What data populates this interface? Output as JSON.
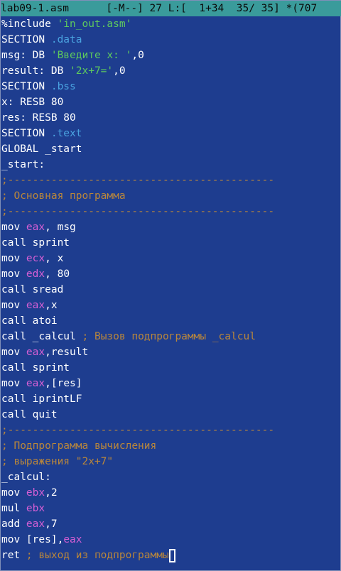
{
  "status": {
    "filename": "lab09-1.asm",
    "info": "[-M--] 27 L:[  1+34  35/ 35] *(707"
  },
  "colors": {
    "background": "#1e3d8f",
    "status_bar": "#3a9b9b",
    "register": "#d45fd4",
    "string": "#5ec95e",
    "comment": "#b8863c",
    "section_name": "#4aa3e0"
  },
  "lines": [
    [
      {
        "t": "%include ",
        "c": "kw"
      },
      {
        "t": "'in_out.asm'",
        "c": "str"
      }
    ],
    [
      {
        "t": "SECTION ",
        "c": "kw"
      },
      {
        "t": ".data",
        "c": "sec"
      }
    ],
    [
      {
        "t": "msg: DB ",
        "c": "kw"
      },
      {
        "t": "'Введите x: '",
        "c": "str"
      },
      {
        "t": ",0",
        "c": "kw"
      }
    ],
    [
      {
        "t": "result: DB ",
        "c": "kw"
      },
      {
        "t": "'2x+7='",
        "c": "str"
      },
      {
        "t": ",0",
        "c": "kw"
      }
    ],
    [
      {
        "t": "SECTION ",
        "c": "kw"
      },
      {
        "t": ".bss",
        "c": "sec"
      }
    ],
    [
      {
        "t": "x: RESB 80",
        "c": "kw"
      }
    ],
    [
      {
        "t": "res: RESB 80",
        "c": "kw"
      }
    ],
    [
      {
        "t": "SECTION ",
        "c": "kw"
      },
      {
        "t": ".text",
        "c": "sec"
      }
    ],
    [
      {
        "t": "GLOBAL _start",
        "c": "kw"
      }
    ],
    [
      {
        "t": "_start:",
        "c": "kw"
      }
    ],
    [
      {
        "t": ";-------------------------------------------",
        "c": "cmt"
      }
    ],
    [
      {
        "t": "; Основная программа",
        "c": "cmt"
      }
    ],
    [
      {
        "t": ";-------------------------------------------",
        "c": "cmt"
      }
    ],
    [
      {
        "t": "mov ",
        "c": "kw"
      },
      {
        "t": "eax",
        "c": "reg"
      },
      {
        "t": ", msg",
        "c": "kw"
      }
    ],
    [
      {
        "t": "call sprint",
        "c": "kw"
      }
    ],
    [
      {
        "t": "mov ",
        "c": "kw"
      },
      {
        "t": "ecx",
        "c": "reg"
      },
      {
        "t": ", x",
        "c": "kw"
      }
    ],
    [
      {
        "t": "mov ",
        "c": "kw"
      },
      {
        "t": "edx",
        "c": "reg"
      },
      {
        "t": ", 80",
        "c": "kw"
      }
    ],
    [
      {
        "t": "call sread",
        "c": "kw"
      }
    ],
    [
      {
        "t": "mov ",
        "c": "kw"
      },
      {
        "t": "eax",
        "c": "reg"
      },
      {
        "t": ",x",
        "c": "kw"
      }
    ],
    [
      {
        "t": "call atoi",
        "c": "kw"
      }
    ],
    [
      {
        "t": "call _calcul ",
        "c": "kw"
      },
      {
        "t": "; Вызов подпрограммы _calcul",
        "c": "cmt"
      }
    ],
    [
      {
        "t": "mov ",
        "c": "kw"
      },
      {
        "t": "eax",
        "c": "reg"
      },
      {
        "t": ",result",
        "c": "kw"
      }
    ],
    [
      {
        "t": "call sprint",
        "c": "kw"
      }
    ],
    [
      {
        "t": "mov ",
        "c": "kw"
      },
      {
        "t": "eax",
        "c": "reg"
      },
      {
        "t": ",[res]",
        "c": "kw"
      }
    ],
    [
      {
        "t": "call iprintLF",
        "c": "kw"
      }
    ],
    [
      {
        "t": "call quit",
        "c": "kw"
      }
    ],
    [
      {
        "t": ";-------------------------------------------",
        "c": "cmt"
      }
    ],
    [
      {
        "t": "; Подпрограмма вычисления",
        "c": "cmt"
      }
    ],
    [
      {
        "t": "; выражения \"2x+7\"",
        "c": "cmt"
      }
    ],
    [
      {
        "t": "_calcul:",
        "c": "kw"
      }
    ],
    [
      {
        "t": "mov ",
        "c": "kw"
      },
      {
        "t": "ebx",
        "c": "reg"
      },
      {
        "t": ",2",
        "c": "kw"
      }
    ],
    [
      {
        "t": "mul ",
        "c": "kw"
      },
      {
        "t": "ebx",
        "c": "reg"
      }
    ],
    [
      {
        "t": "add ",
        "c": "kw"
      },
      {
        "t": "eax",
        "c": "reg"
      },
      {
        "t": ",7",
        "c": "kw"
      }
    ],
    [
      {
        "t": "mov [res],",
        "c": "kw"
      },
      {
        "t": "eax",
        "c": "reg"
      }
    ],
    [
      {
        "t": "ret ",
        "c": "kw"
      },
      {
        "t": "; выход из подпрограммы",
        "c": "cmt"
      }
    ]
  ],
  "cursor": {
    "line": 35
  }
}
